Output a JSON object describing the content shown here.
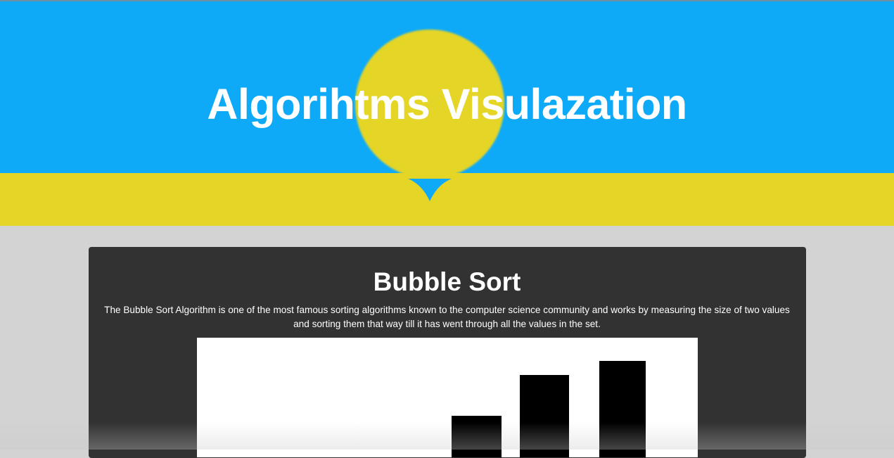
{
  "header": {
    "title": "Algorihtms Visulazation",
    "colors": {
      "sky": "#0eaaf8",
      "sun": "#e4d526",
      "ground": "#e4d526"
    }
  },
  "section": {
    "title": "Bubble Sort",
    "description": "The Bubble Sort Algorithm is one of the most famous sorting algorithms known to the computer science community and works by measuring the size of two values and sorting them that way till it has went through all the values in the set.",
    "colors": {
      "card": "#323232",
      "canvas": "#ffffff",
      "bar": "#000000"
    }
  },
  "visualization": {
    "bars_visible": 3,
    "bar_height_ratio_visible": [
      0.45,
      0.83,
      0.98
    ]
  }
}
